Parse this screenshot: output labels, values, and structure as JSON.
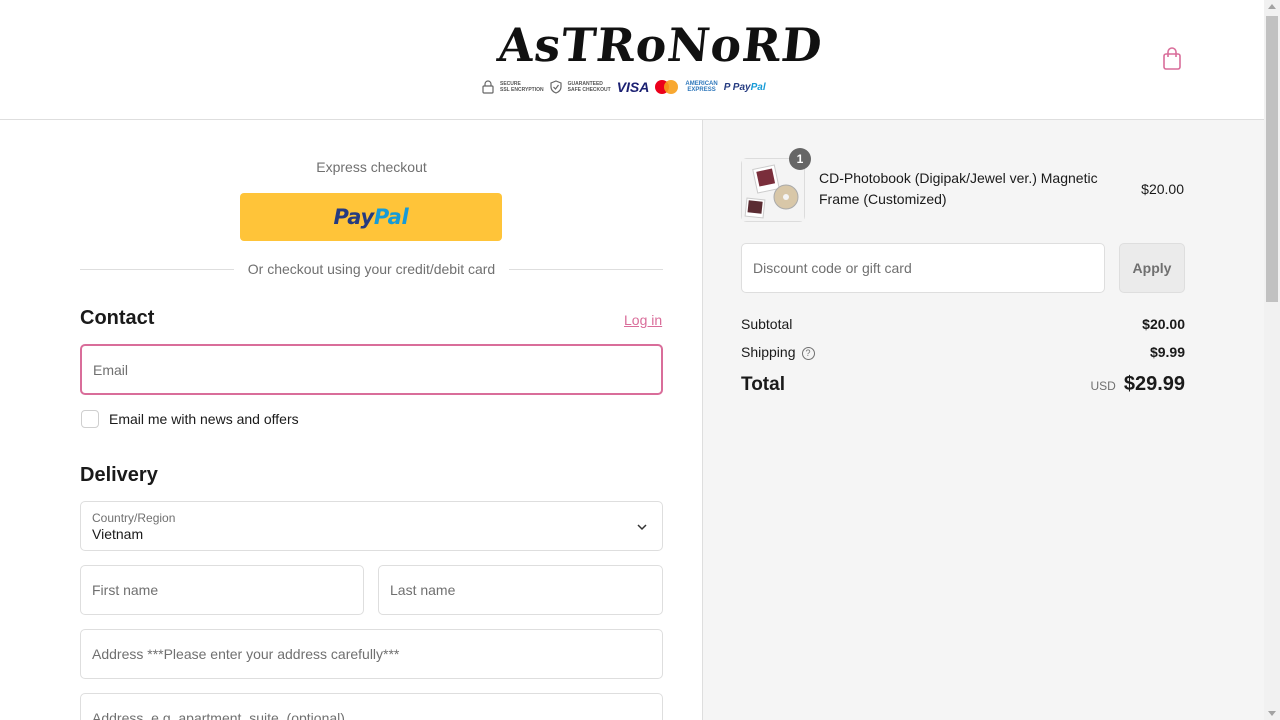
{
  "header": {
    "logo_text": "AsTRoNoRD",
    "badges": {
      "secure_line1": "SECURE",
      "secure_line2": "SSL ENCRYPTION",
      "guaranteed_line1": "GUARANTEED",
      "guaranteed_line2": "SAFE CHECKOUT",
      "visa": "VISA",
      "amex_line1": "AMERICAN",
      "amex_line2": "EXPRESS",
      "paypal_pay": "Pay",
      "paypal_pal": "Pal"
    },
    "cart_icon": "shopping-bag-icon",
    "accent_color": "#d96d9a"
  },
  "express": {
    "label": "Express checkout",
    "paypal_pay": "Pay",
    "paypal_pal": "Pal",
    "paypal_color": "#ffc439",
    "divider_text": "Or checkout using your credit/debit card"
  },
  "contact": {
    "title": "Contact",
    "login_link": "Log in",
    "email_placeholder": "Email",
    "newsletter_label": "Email me with news and offers"
  },
  "delivery": {
    "title": "Delivery",
    "country_label": "Country/Region",
    "country_value": "Vietnam",
    "first_name_placeholder": "First name",
    "last_name_placeholder": "Last name",
    "address_placeholder": "Address ***Please enter your address carefully***",
    "address2_placeholder": "Address, e.g. apartment, suite, (optional)"
  },
  "summary": {
    "item": {
      "quantity": "1",
      "title": "CD-Photobook (Digipak/Jewel ver.) Magnetic Frame (Customized)",
      "price": "$20.00"
    },
    "discount_placeholder": "Discount code or gift card",
    "apply_label": "Apply",
    "subtotal_label": "Subtotal",
    "subtotal_value": "$20.00",
    "shipping_label": "Shipping",
    "shipping_value": "$9.99",
    "total_label": "Total",
    "currency": "USD",
    "total_value": "$29.99"
  }
}
